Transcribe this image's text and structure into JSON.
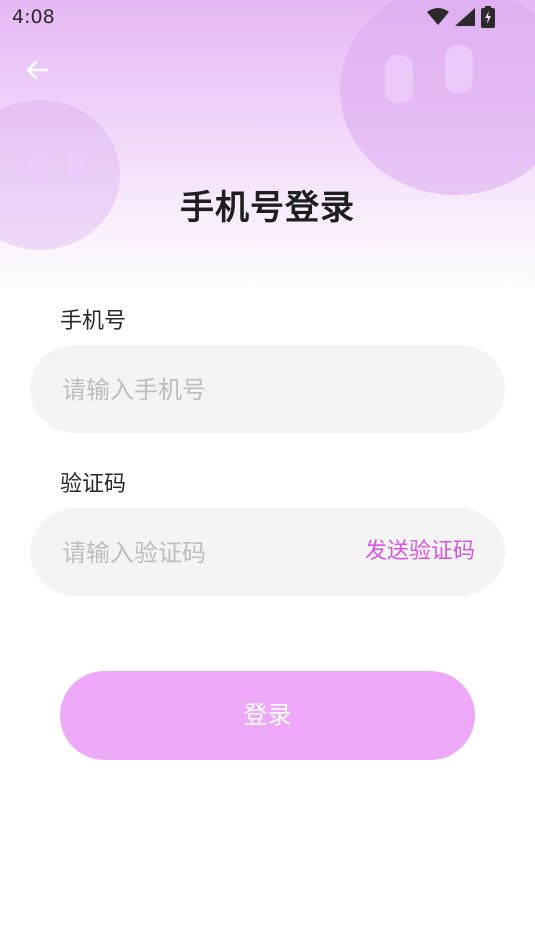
{
  "status_bar": {
    "time": "4:08"
  },
  "page": {
    "title": "手机号登录"
  },
  "phone": {
    "label": "手机号",
    "placeholder": "请输入手机号",
    "value": ""
  },
  "code": {
    "label": "验证码",
    "placeholder": "请输入验证码",
    "value": "",
    "send_label": "发送验证码"
  },
  "login": {
    "label": "登录"
  },
  "colors": {
    "accent": "#d757e2",
    "button": "#eea8f8",
    "field_bg": "#f4f4f4",
    "header_gradient_top": "#e5b9f4"
  },
  "icons": {
    "back": "back-arrow-icon",
    "wifi": "wifi-icon",
    "signal": "signal-icon",
    "battery": "battery-icon"
  }
}
